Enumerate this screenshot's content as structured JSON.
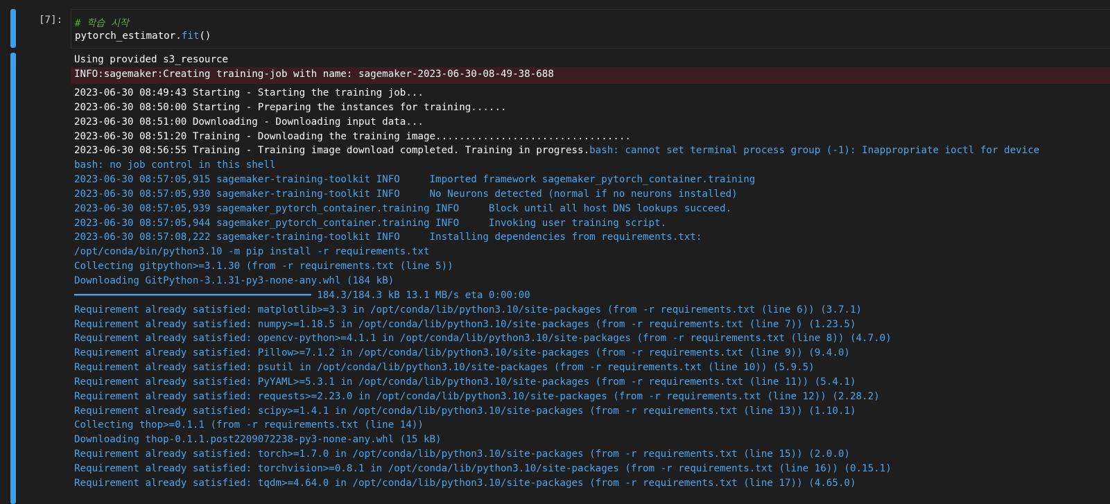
{
  "cell": {
    "prompt": "[7]:",
    "code_comment": "# 학습 시작",
    "code_obj": "pytorch_estimator.",
    "code_fn": "fit",
    "code_parens": "()"
  },
  "output": {
    "stdout_first": "Using provided s3_resource",
    "stderr_line": "INFO:sagemaker:Creating training-job with name: sagemaker-2023-06-30-08-49-38-688",
    "log_lines": [
      {
        "white": "2023-06-30 08:49:43 Starting - Starting the training job...",
        "blue": ""
      },
      {
        "white": "2023-06-30 08:50:00 Starting - Preparing the instances for training......",
        "blue": ""
      },
      {
        "white": "2023-06-30 08:51:00 Downloading - Downloading input data...",
        "blue": ""
      },
      {
        "white": "2023-06-30 08:51:20 Training - Downloading the training image.................................",
        "blue": ""
      },
      {
        "white": "2023-06-30 08:56:55 Training - Training image download completed. Training in progress.",
        "blue": "bash: cannot set terminal process group (-1): Inappropriate ioctl for device"
      },
      {
        "white": "",
        "blue": "bash: no job control in this shell"
      },
      {
        "white": "",
        "blue": "2023-06-30 08:57:05,915 sagemaker-training-toolkit INFO     Imported framework sagemaker_pytorch_container.training"
      },
      {
        "white": "",
        "blue": "2023-06-30 08:57:05,930 sagemaker-training-toolkit INFO     No Neurons detected (normal if no neurons installed)"
      },
      {
        "white": "",
        "blue": "2023-06-30 08:57:05,939 sagemaker_pytorch_container.training INFO     Block until all host DNS lookups succeed."
      },
      {
        "white": "",
        "blue": "2023-06-30 08:57:05,944 sagemaker_pytorch_container.training INFO     Invoking user training script."
      },
      {
        "white": "",
        "blue": "2023-06-30 08:57:08,222 sagemaker-training-toolkit INFO     Installing dependencies from requirements.txt:"
      },
      {
        "white": "",
        "blue": "/opt/conda/bin/python3.10 -m pip install -r requirements.txt"
      },
      {
        "white": "",
        "blue": "Collecting gitpython>=3.1.30 (from -r requirements.txt (line 5))"
      },
      {
        "white": "",
        "blue": "Downloading GitPython-3.1.31-py3-none-any.whl (184 kB)"
      },
      {
        "white": "",
        "blue": "━━━━━━━━━━━━━━━━━━━━━━━━━━━━━━━━━━━━━━━━ 184.3/184.3 kB 13.1 MB/s eta 0:00:00"
      },
      {
        "white": "",
        "blue": "Requirement already satisfied: matplotlib>=3.3 in /opt/conda/lib/python3.10/site-packages (from -r requirements.txt (line 6)) (3.7.1)"
      },
      {
        "white": "",
        "blue": "Requirement already satisfied: numpy>=1.18.5 in /opt/conda/lib/python3.10/site-packages (from -r requirements.txt (line 7)) (1.23.5)"
      },
      {
        "white": "",
        "blue": "Requirement already satisfied: opencv-python>=4.1.1 in /opt/conda/lib/python3.10/site-packages (from -r requirements.txt (line 8)) (4.7.0)"
      },
      {
        "white": "",
        "blue": "Requirement already satisfied: Pillow>=7.1.2 in /opt/conda/lib/python3.10/site-packages (from -r requirements.txt (line 9)) (9.4.0)"
      },
      {
        "white": "",
        "blue": "Requirement already satisfied: psutil in /opt/conda/lib/python3.10/site-packages (from -r requirements.txt (line 10)) (5.9.5)"
      },
      {
        "white": "",
        "blue": "Requirement already satisfied: PyYAML>=5.3.1 in /opt/conda/lib/python3.10/site-packages (from -r requirements.txt (line 11)) (5.4.1)"
      },
      {
        "white": "",
        "blue": "Requirement already satisfied: requests>=2.23.0 in /opt/conda/lib/python3.10/site-packages (from -r requirements.txt (line 12)) (2.28.2)"
      },
      {
        "white": "",
        "blue": "Requirement already satisfied: scipy>=1.4.1 in /opt/conda/lib/python3.10/site-packages (from -r requirements.txt (line 13)) (1.10.1)"
      },
      {
        "white": "",
        "blue": "Collecting thop>=0.1.1 (from -r requirements.txt (line 14))"
      },
      {
        "white": "",
        "blue": "Downloading thop-0.1.1.post2209072238-py3-none-any.whl (15 kB)"
      },
      {
        "white": "",
        "blue": "Requirement already satisfied: torch>=1.7.0 in /opt/conda/lib/python3.10/site-packages (from -r requirements.txt (line 15)) (2.0.0)"
      },
      {
        "white": "",
        "blue": "Requirement already satisfied: torchvision>=0.8.1 in /opt/conda/lib/python3.10/site-packages (from -r requirements.txt (line 16)) (0.15.1)"
      },
      {
        "white": "",
        "blue": "Requirement already satisfied: tqdm>=4.64.0 in /opt/conda/lib/python3.10/site-packages (from -r requirements.txt (line 17)) (4.65.0)"
      }
    ]
  },
  "colors": {
    "background": "#1e1e1e",
    "cell_bar": "#3aa0e8",
    "stderr_bg": "#3a1c22",
    "log_blue": "#4ca4ec",
    "comment": "#6a9955"
  }
}
